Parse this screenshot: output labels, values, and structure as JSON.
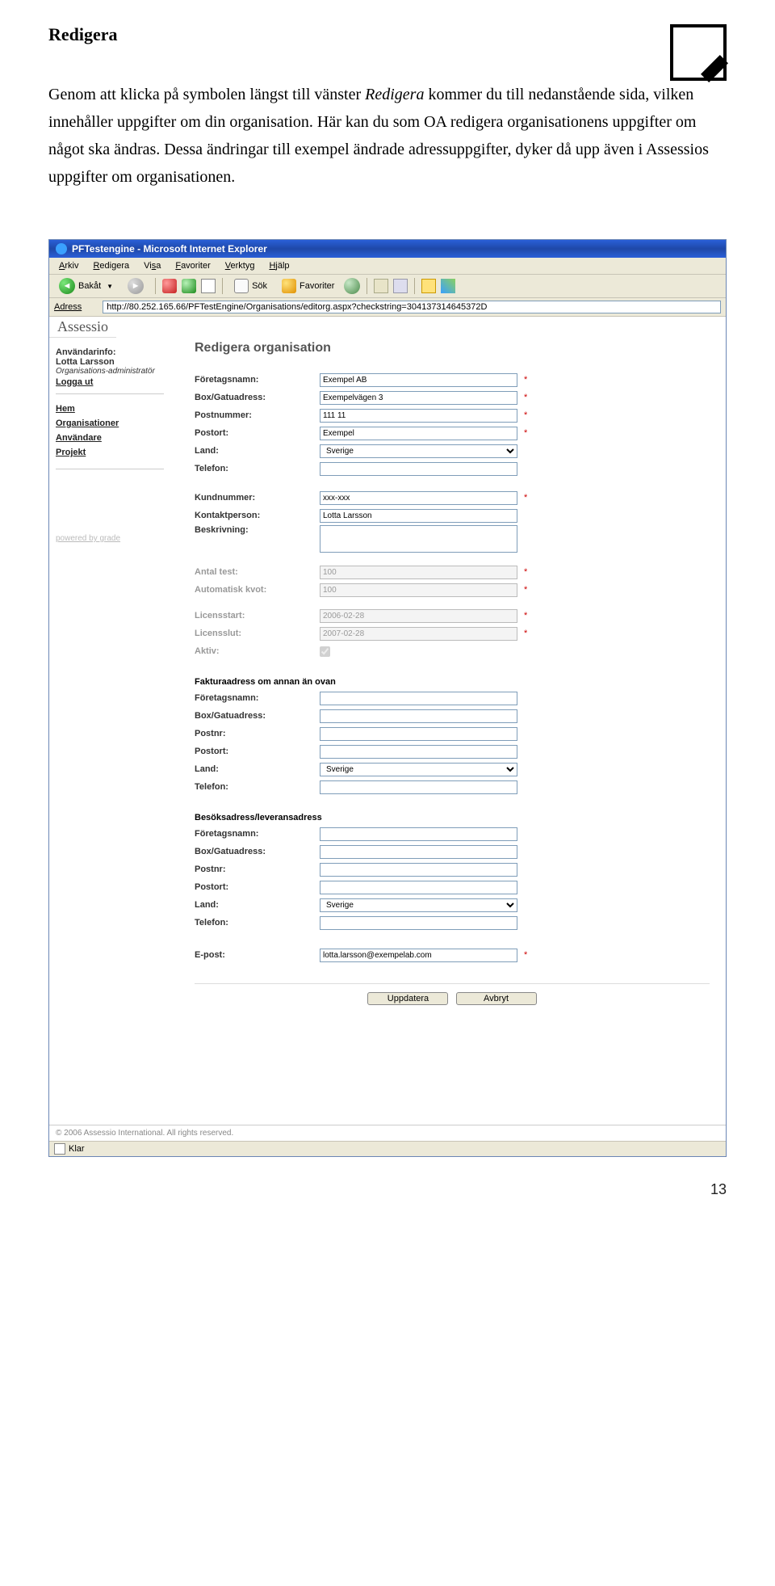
{
  "doc": {
    "heading": "Redigera",
    "para_pre": "Genom att klicka på symbolen längst till vänster ",
    "para_em": "Redigera",
    "para_post": " kommer du till nedanstående sida, vilken innehåller uppgifter om din organisation. Här kan du som OA redigera organisationens uppgifter om något ska ändras. Dessa ändringar till exempel ändrade adressuppgifter, dyker då upp även i Assessios uppgifter om organisationen.",
    "page_number": "13"
  },
  "window": {
    "title": "PFTestengine - Microsoft Internet Explorer",
    "menu": [
      "Arkiv",
      "Redigera",
      "Visa",
      "Favoriter",
      "Verktyg",
      "Hjälp"
    ],
    "toolbar": {
      "back": "Bakåt",
      "search": "Sök",
      "fav": "Favoriter"
    },
    "address_label": "Adress",
    "address": "http://80.252.165.66/PFTestEngine/Organisations/editorg.aspx?checkstring=304137314645372D",
    "status": "Klar"
  },
  "brand": "Assessio",
  "sidebar": {
    "userinfo_label": "Användarinfo:",
    "user": "Lotta Larsson",
    "role": "Organisations-administratör",
    "logout": "Logga ut",
    "nav": [
      "Hem",
      "Organisationer",
      "Användare",
      "Projekt"
    ],
    "powered": "powered by grade"
  },
  "form": {
    "title": "Redigera organisation",
    "rows": {
      "company": {
        "l": "Företagsnamn:",
        "v": "Exempel AB",
        "r": true
      },
      "street": {
        "l": "Box/Gatuadress:",
        "v": "Exempelvägen 3",
        "r": true
      },
      "zip": {
        "l": "Postnummer:",
        "v": "111 11",
        "r": true
      },
      "city": {
        "l": "Postort:",
        "v": "Exempel",
        "r": true
      },
      "country": {
        "l": "Land:",
        "v": "Sverige"
      },
      "phone": {
        "l": "Telefon:",
        "v": ""
      },
      "custno": {
        "l": "Kundnummer:",
        "v": "xxx-xxx",
        "r": true
      },
      "contact": {
        "l": "Kontaktperson:",
        "v": "Lotta Larsson"
      },
      "desc": {
        "l": "Beskrivning:",
        "v": ""
      },
      "ntest": {
        "l": "Antal test:",
        "v": "100",
        "r": true,
        "faded": true
      },
      "quota": {
        "l": "Automatisk kvot:",
        "v": "100",
        "r": true,
        "faded": true
      },
      "licstart": {
        "l": "Licensstart:",
        "v": "2006-02-28",
        "r": true,
        "faded": true
      },
      "licend": {
        "l": "Licensslut:",
        "v": "2007-02-28",
        "r": true,
        "faded": true
      },
      "active": {
        "l": "Aktiv:",
        "faded": true
      }
    },
    "section2": "Fakturaadress om annan än ovan",
    "rows2": {
      "company": {
        "l": "Företagsnamn:"
      },
      "street": {
        "l": "Box/Gatuadress:"
      },
      "zip": {
        "l": "Postnr:"
      },
      "city": {
        "l": "Postort:"
      },
      "country": {
        "l": "Land:",
        "v": "Sverige"
      },
      "phone": {
        "l": "Telefon:"
      }
    },
    "section3": "Besöksadress/leveransadress",
    "rows3": {
      "company": {
        "l": "Företagsnamn:"
      },
      "street": {
        "l": "Box/Gatuadress:"
      },
      "zip": {
        "l": "Postnr:"
      },
      "city": {
        "l": "Postort:"
      },
      "country": {
        "l": "Land:",
        "v": "Sverige"
      },
      "phone": {
        "l": "Telefon:"
      }
    },
    "email": {
      "l": "E-post:",
      "v": "lotta.larsson@exempelab.com",
      "r": true
    },
    "buttons": {
      "update": "Uppdatera",
      "cancel": "Avbryt"
    }
  },
  "footer": "© 2006 Assessio International. All rights reserved."
}
